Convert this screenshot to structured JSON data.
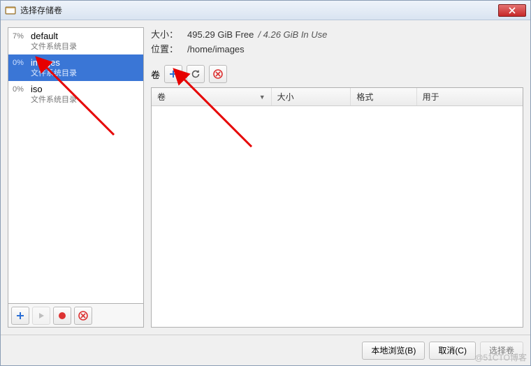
{
  "window": {
    "title": "选择存储卷"
  },
  "sidebar": {
    "pools": [
      {
        "pct": "7%",
        "name": "default",
        "sub": "文件系统目录",
        "selected": false
      },
      {
        "pct": "0%",
        "name": "images",
        "sub": "文件系统目录",
        "selected": true
      },
      {
        "pct": "0%",
        "name": "iso",
        "sub": "文件系统目录",
        "selected": false
      }
    ],
    "toolbar": {
      "add_icon": "plus",
      "play_icon": "play",
      "stop_icon": "stop",
      "delete_icon": "delete"
    }
  },
  "info": {
    "size_label": "大小：",
    "size_free": "495.29 GiB Free",
    "size_sep": " / ",
    "size_used": "4.26 GiB In Use",
    "loc_label": "位置：",
    "loc_value": "/home/images"
  },
  "vol_toolbar": {
    "label": "卷"
  },
  "table": {
    "columns": {
      "vol": "卷",
      "size": "大小",
      "fmt": "格式",
      "used": "用于"
    }
  },
  "footer": {
    "browse": "本地浏览(B)",
    "cancel": "取消(C)",
    "choose": "选择卷"
  },
  "watermark": "@51CTO博客"
}
